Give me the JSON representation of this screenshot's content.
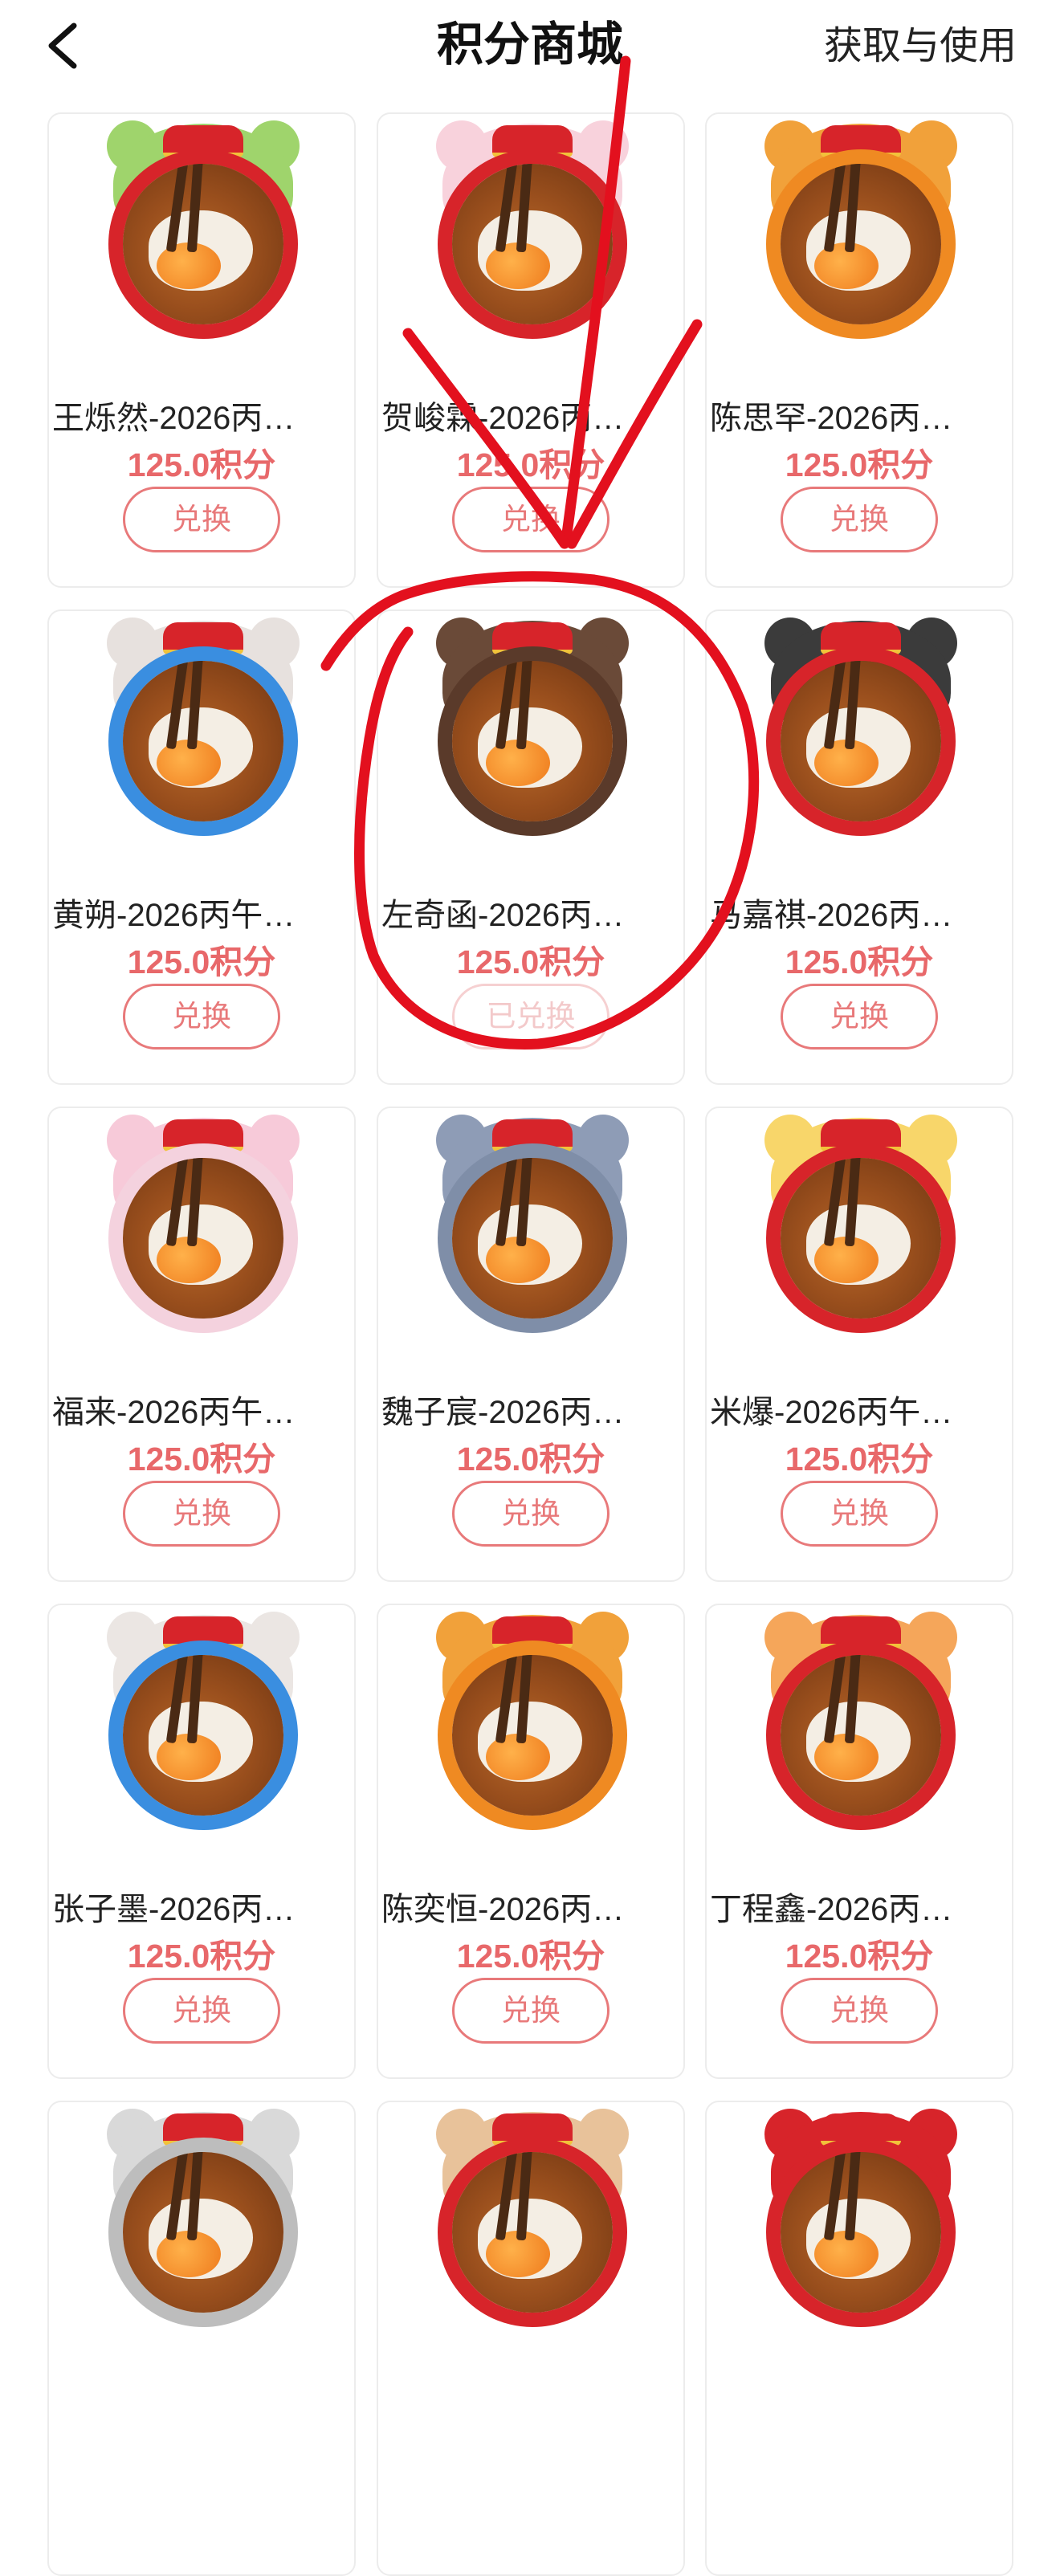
{
  "header": {
    "title": "积分商城",
    "right_link": "获取与使用",
    "back_icon": "chevron-left-icon"
  },
  "colors": {
    "accent": "#e8686a",
    "button_border": "#e8797a",
    "button_disabled": "#f3c9ca",
    "annotation": "#e3101e"
  },
  "products": [
    {
      "title": "王烁然-2026丙…",
      "price": "125.0积分",
      "button": "兑换",
      "redeemed": false,
      "hat_color": "#9fd46c",
      "ring_color": "#d7242a"
    },
    {
      "title": "贺峻霖-2026丙…",
      "price": "125.0积分",
      "button": "兑换",
      "redeemed": false,
      "hat_color": "#f8d2dc",
      "ring_color": "#d7242a"
    },
    {
      "title": "陈思罕-2026丙…",
      "price": "125.0积分",
      "button": "兑换",
      "redeemed": false,
      "hat_color": "#f1a13a",
      "ring_color": "#ef8a22"
    },
    {
      "title": "黄朔-2026丙午…",
      "price": "125.0积分",
      "button": "兑换",
      "redeemed": false,
      "hat_color": "#e7e1de",
      "ring_color": "#3a8ee0"
    },
    {
      "title": "左奇函-2026丙…",
      "price": "125.0积分",
      "button": "已兑换",
      "redeemed": true,
      "hat_color": "#6a4a38",
      "ring_color": "#5a3a2a"
    },
    {
      "title": "马嘉祺-2026丙…",
      "price": "125.0积分",
      "button": "兑换",
      "redeemed": false,
      "hat_color": "#3b3b3b",
      "ring_color": "#d7242a"
    },
    {
      "title": "福来-2026丙午…",
      "price": "125.0积分",
      "button": "兑换",
      "redeemed": false,
      "hat_color": "#f7cad9",
      "ring_color": "#f4d2de"
    },
    {
      "title": "魏子宸-2026丙…",
      "price": "125.0积分",
      "button": "兑换",
      "redeemed": false,
      "hat_color": "#8e9cb6",
      "ring_color": "#7f8ea8"
    },
    {
      "title": "米爆-2026丙午…",
      "price": "125.0积分",
      "button": "兑换",
      "redeemed": false,
      "hat_color": "#f8d66a",
      "ring_color": "#d7242a"
    },
    {
      "title": "张子墨-2026丙…",
      "price": "125.0积分",
      "button": "兑换",
      "redeemed": false,
      "hat_color": "#ebe6e3",
      "ring_color": "#3a8ee0"
    },
    {
      "title": "陈奕恒-2026丙…",
      "price": "125.0积分",
      "button": "兑换",
      "redeemed": false,
      "hat_color": "#f1a13a",
      "ring_color": "#ef8a22"
    },
    {
      "title": "丁程鑫-2026丙…",
      "price": "125.0积分",
      "button": "兑换",
      "redeemed": false,
      "hat_color": "#f5a65a",
      "ring_color": "#d7242a"
    }
  ],
  "partial_row": [
    {
      "hat_color": "#d9d9d9",
      "ring_color": "#bdbdbd"
    },
    {
      "hat_color": "#e8c29a",
      "ring_color": "#d7242a"
    },
    {
      "hat_color": "#d7242a",
      "ring_color": "#d7242a"
    }
  ]
}
